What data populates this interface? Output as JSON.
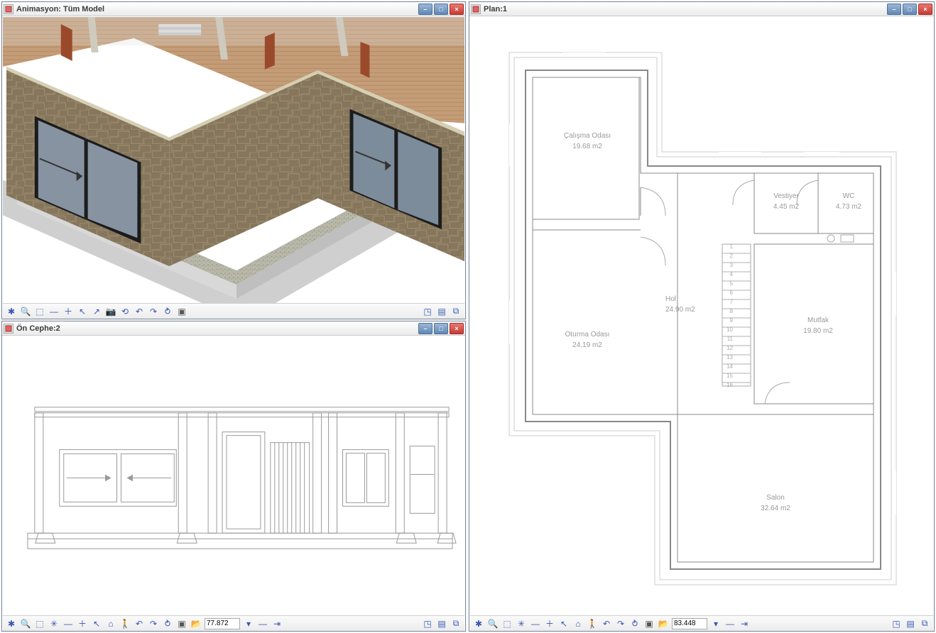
{
  "windows": {
    "animasyon": {
      "title": "Animasyon: Tüm Model"
    },
    "plan": {
      "title": "Plan:1"
    },
    "oncephe": {
      "title": "Ön Cephe:2"
    }
  },
  "rooms": {
    "calisma": {
      "name": "Çalışma Odası",
      "area": "19.68 m2"
    },
    "vestiyer": {
      "name": "Vestiyer",
      "area": "4.45 m2"
    },
    "wc": {
      "name": "WC",
      "area": "4.73 m2"
    },
    "hol": {
      "name": "Hol",
      "area": "24.90 m2"
    },
    "mutfak": {
      "name": "Mutfak",
      "area": "19.80 m2"
    },
    "oturma": {
      "name": "Oturma Odası",
      "area": "24.19 m2"
    },
    "salon": {
      "name": "Salon",
      "area": "32.64 m2"
    }
  },
  "stairs": [
    "1",
    "2",
    "3",
    "4",
    "5",
    "6",
    "7",
    "8",
    "9",
    "10",
    "11",
    "12",
    "13",
    "14",
    "15",
    "16"
  ],
  "status": {
    "oncephe_value": "77.872",
    "plan_value": "83.448"
  }
}
